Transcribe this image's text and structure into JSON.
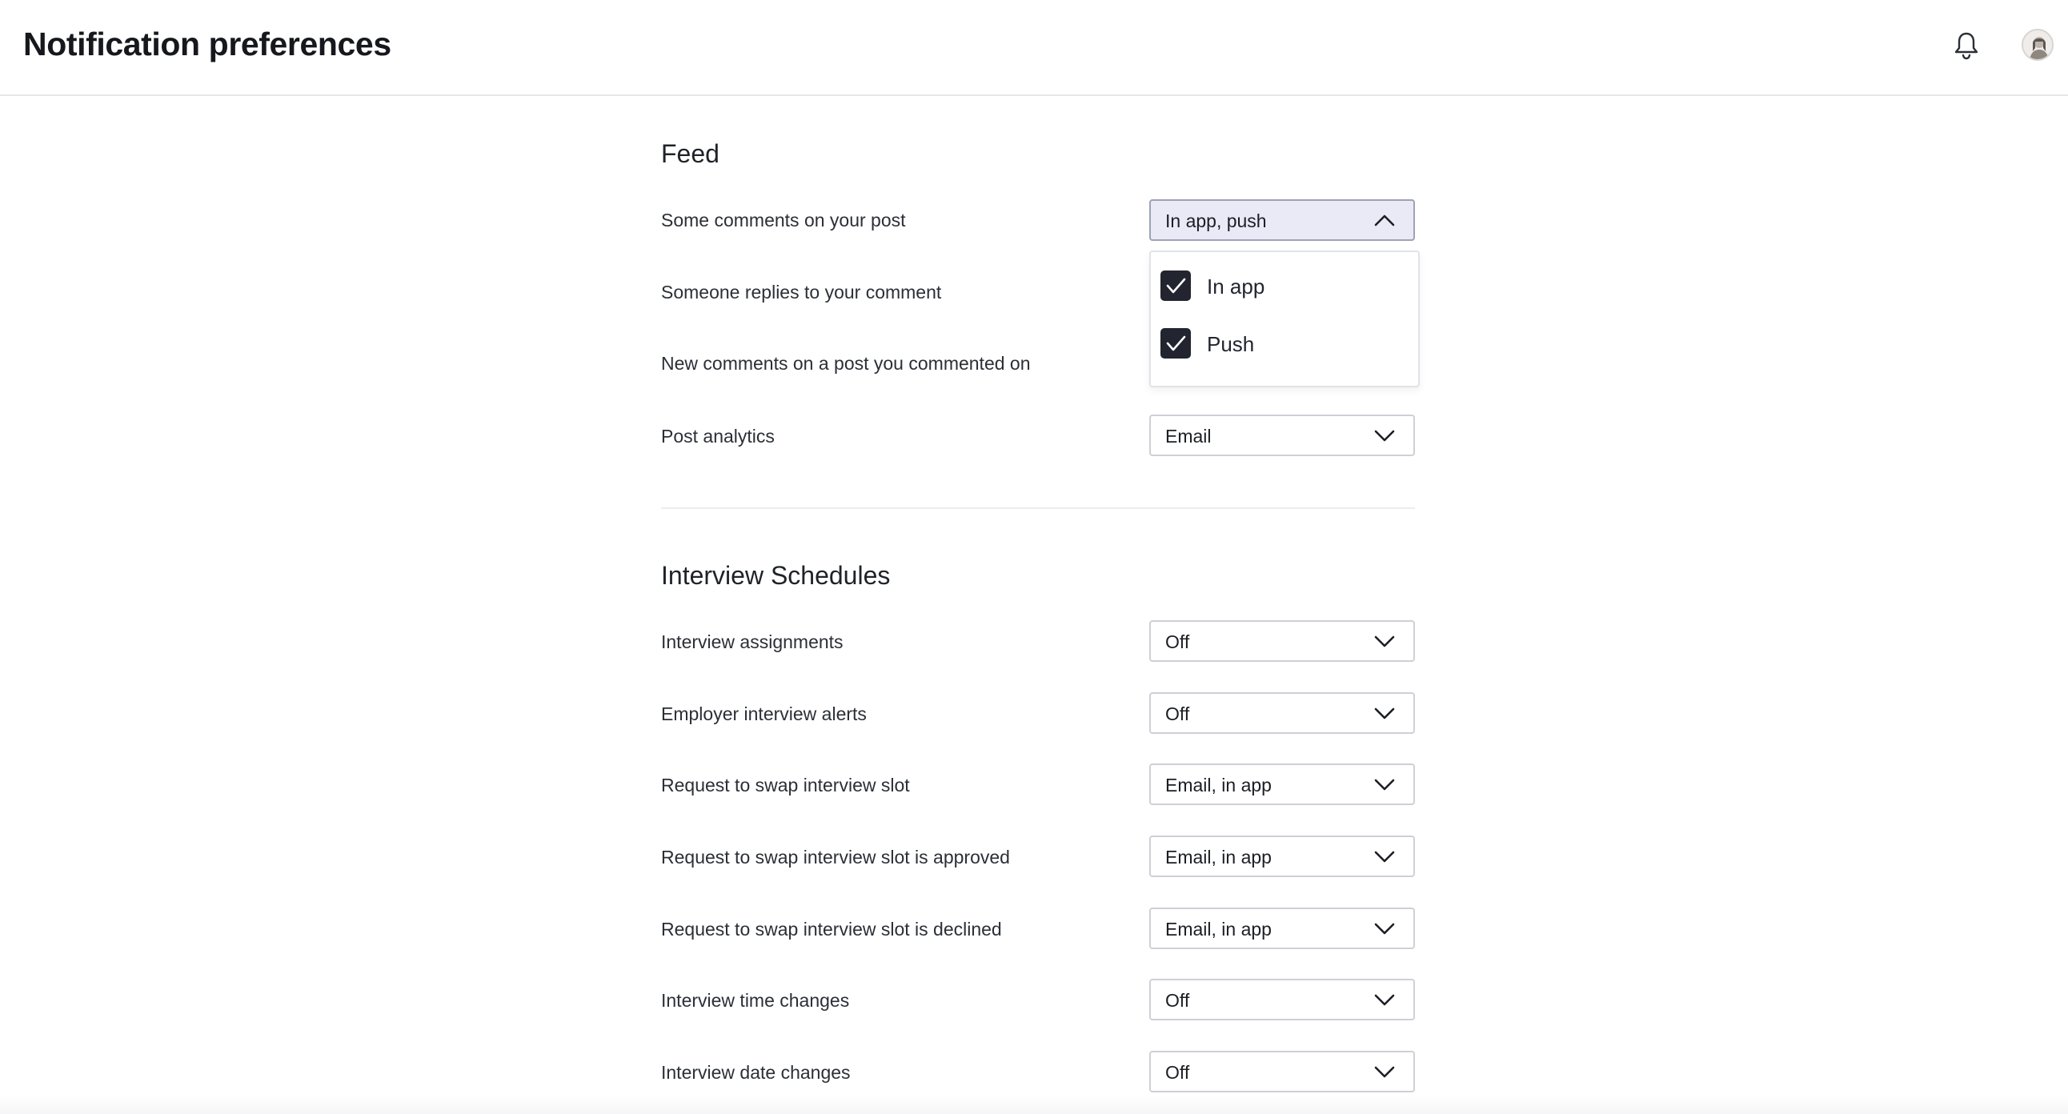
{
  "header": {
    "title": "Notification preferences",
    "icons": [
      "bell-icon",
      "user-avatar"
    ]
  },
  "sections": [
    {
      "title": "Feed",
      "rows": [
        {
          "label": "Some comments on your post",
          "value": "In app, push",
          "open": true
        },
        {
          "label": "Someone replies to your comment",
          "value": ""
        },
        {
          "label": "New comments on a post you commented on",
          "value": ""
        },
        {
          "label": "Post analytics",
          "value": "Email"
        }
      ]
    },
    {
      "title": "Interview Schedules",
      "rows": [
        {
          "label": "Interview assignments",
          "value": "Off"
        },
        {
          "label": "Employer interview alerts",
          "value": "Off"
        },
        {
          "label": "Request to swap interview slot",
          "value": "Email, in app"
        },
        {
          "label": "Request to swap interview slot is approved",
          "value": "Email, in app"
        },
        {
          "label": "Request to swap interview slot is declined",
          "value": "Email, in app"
        },
        {
          "label": "Interview time changes",
          "value": "Off"
        },
        {
          "label": "Interview date changes",
          "value": "Off"
        }
      ]
    }
  ],
  "dropdown": {
    "options": [
      {
        "label": "In app",
        "checked": true
      },
      {
        "label": "Push",
        "checked": true
      }
    ]
  },
  "colors": {
    "accent_dark": "#22252f",
    "open_select_bg": "#e9eaf6",
    "border": "#cdd0d6"
  }
}
